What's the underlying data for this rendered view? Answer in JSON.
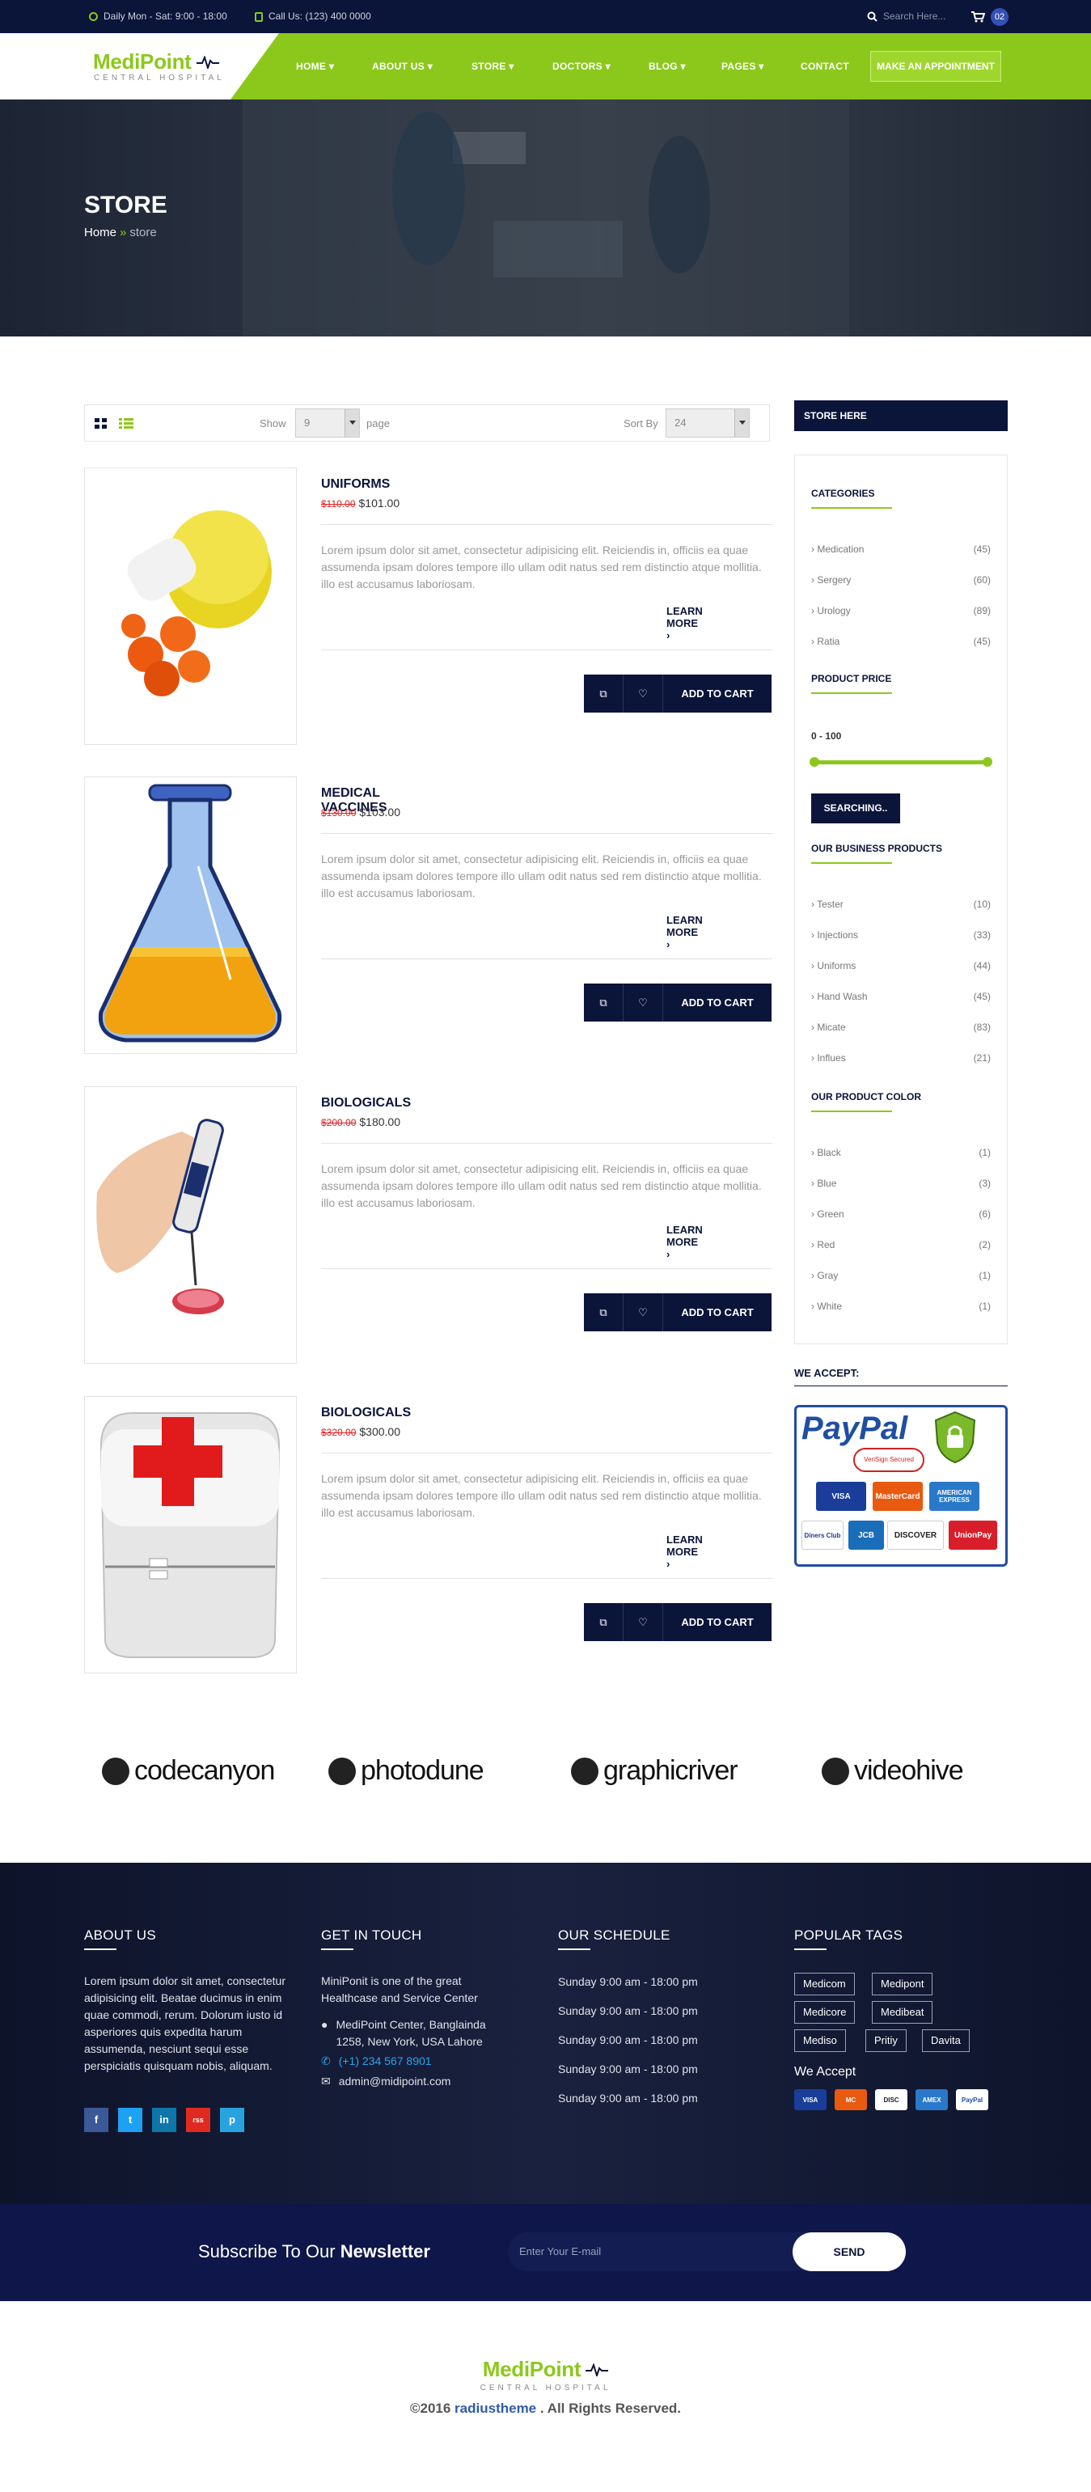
{
  "topbar": {
    "hours": "Daily Mon - Sat: 9:00 - 18:00",
    "phone": "Call Us: (123) 400 0000",
    "search_placeholder": "Search Here...",
    "cart_count": "02"
  },
  "brand": {
    "name": "MediPoint",
    "tagline": "CENTRAL HOSPITAL"
  },
  "nav": {
    "items": [
      "HOME",
      "ABOUT US",
      "STORE",
      "DOCTORS",
      "BLOG",
      "PAGES",
      "CONTACT"
    ],
    "cta": "MAKE AN APPOINTMENT"
  },
  "hero": {
    "title": "STORE",
    "breadcrumb_home": "Home",
    "breadcrumb_current": "store"
  },
  "toolbar": {
    "show_label": "Show",
    "show_value": "9",
    "page_label": "page",
    "sort_label": "Sort By",
    "sort_value": "24"
  },
  "products": [
    {
      "name": "UNIFORMS",
      "old_price": "$110.00",
      "price": "$101.00",
      "image": "pill-bottle-image"
    },
    {
      "name": "MEDICAL VACCINES",
      "old_price": "$130.00",
      "price": "$103.00",
      "image": "flask-image"
    },
    {
      "name": "BIOLOGICALS",
      "old_price": "$200.00",
      "price": "$180.00",
      "image": "pipette-image"
    },
    {
      "name": "BIOLOGICALS",
      "old_price": "$320.00",
      "price": "$300.00",
      "image": "first-aid-box-image"
    }
  ],
  "product_common": {
    "description": "Lorem ipsum dolor sit amet, consectetur adipisicing elit. Reiciendis in, officiis ea quae assumenda ipsam dolores tempore illo ullam odit natus sed rem distinctio atque mollitia. illo est accusamus laboriosam.",
    "learn_more": "LEARN MORE",
    "add_to_cart": "ADD TO CART"
  },
  "sidebar": {
    "header": "STORE HERE",
    "categories_title": "CATEGORIES",
    "categories": [
      {
        "label": "Medication",
        "count": "(45)"
      },
      {
        "label": "Sergery",
        "count": "(60)"
      },
      {
        "label": "Urology",
        "count": "(89)"
      },
      {
        "label": "Ratia",
        "count": "(45)"
      }
    ],
    "price_title": "PRODUCT PRICE",
    "price_range": "0 - 100",
    "search_button": "SEARCHING..",
    "business_title": "OUR BUSINESS PRODUCTS",
    "business": [
      {
        "label": "Tester",
        "count": "(10)"
      },
      {
        "label": "Injections",
        "count": "(33)"
      },
      {
        "label": "Uniforms",
        "count": "(44)"
      },
      {
        "label": "Hand Wash",
        "count": "(45)"
      },
      {
        "label": "Micate",
        "count": "(83)"
      },
      {
        "label": "Influes",
        "count": "(21)"
      }
    ],
    "color_title": "OUR PRODUCT COLOR",
    "colors": [
      {
        "label": "Black",
        "count": "(1)"
      },
      {
        "label": "Blue",
        "count": "(3)"
      },
      {
        "label": "Green",
        "count": "(6)"
      },
      {
        "label": "Red",
        "count": "(2)"
      },
      {
        "label": "Gray",
        "count": "(1)"
      },
      {
        "label": "White",
        "count": "(1)"
      }
    ],
    "we_accept": "WE ACCEPT:",
    "paypal_text": "PayPal",
    "verified_text": "VeriSign Secured",
    "cards": [
      "VISA",
      "MasterCard",
      "AMERICAN EXPRESS",
      "Diners Club",
      "JCB",
      "DISCOVER",
      "UnionPay"
    ]
  },
  "brands": [
    "codecanyon",
    "photodune",
    "graphicriver",
    "videohive"
  ],
  "footer": {
    "about_title": "ABOUT US",
    "about_text": "Lorem ipsum dolor sit amet, consectetur adipisicing elit. Beatae ducimus in enim quae commodi, rerum. Dolorum iusto id asperiores quis expedita harum assumenda, nesciunt sequi esse perspiciatis quisquam nobis, aliquam.",
    "touch_title": "GET IN TOUCH",
    "touch_text": "MiniPonit is one of the great Healthcase and Service Center",
    "address": "MediPoint Center, Banglainda 1258, New York, USA Lahore",
    "phone": "(+1) 234 567 8901",
    "email": "admin@midipoint.com",
    "schedule_title": "OUR SCHEDULE",
    "schedule": [
      "Sunday 9:00 am - 18:00 pm",
      "Sunday 9:00 am - 18:00 pm",
      "Sunday 9:00 am - 18:00 pm",
      "Sunday 9:00 am - 18:00 pm",
      "Sunday 9:00 am - 18:00 pm"
    ],
    "tags_title": "POPULAR TAGS",
    "tags": [
      "Medicom",
      "Medipont",
      "Medicore",
      "Medibeat",
      "Mediso",
      "Pritiy",
      "Davita"
    ],
    "we_accept": "We Accept",
    "mini_cards": [
      "VISA",
      "MC",
      "DISC",
      "AMEX",
      "PayPal"
    ],
    "social": [
      "f",
      "t",
      "in",
      "rss",
      "p"
    ]
  },
  "newsletter": {
    "title_prefix": "Subscribe To Our ",
    "title_bold": "Newsletter",
    "placeholder": "Enter Your E-mail",
    "button": "SEND"
  },
  "copyright": {
    "prefix": "©2016 ",
    "brand": "radiustheme",
    "suffix": " . All Rights Reserved."
  },
  "colors": {
    "navy": "#0b1439",
    "green": "#8cc81c",
    "red": "#e02020"
  }
}
